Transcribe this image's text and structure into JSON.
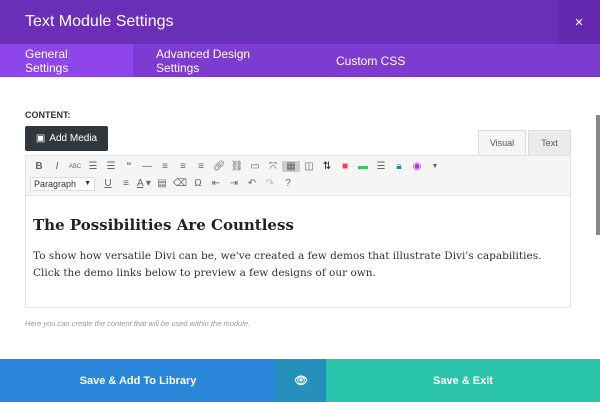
{
  "header": {
    "title": "Text Module Settings",
    "close": "×"
  },
  "tabs": [
    {
      "label": "General Settings"
    },
    {
      "label": "Advanced Design Settings"
    },
    {
      "label": "Custom CSS"
    }
  ],
  "content_label": "CONTENT:",
  "add_media": "Add Media",
  "editor_tabs": {
    "visual": "Visual",
    "text": "Text"
  },
  "toolbar": {
    "format_select": "Paragraph"
  },
  "body": {
    "heading": "The Possibilities Are Countless",
    "paragraph": "To show how versatile Divi can be, we've created a few demos that illustrate Divi's capabilities. Click the demo links below to preview a few designs of our own."
  },
  "help_text": "Here you can create the content that will be used within the module.",
  "footer": {
    "save_library": "Save & Add To Library",
    "save_exit": "Save & Exit"
  }
}
